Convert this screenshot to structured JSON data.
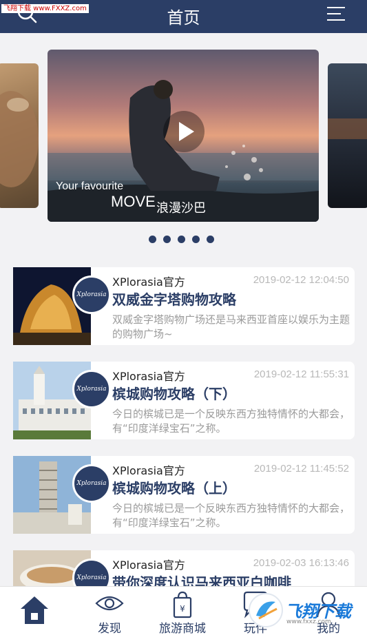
{
  "header": {
    "title": "首页",
    "watermark": "飞翔下载 www.FXXZ.com"
  },
  "carousel": {
    "caption_line1": "Your favourite",
    "caption_move": "MOVE",
    "caption_place": "浪漫沙巴",
    "slides_count": 5
  },
  "articles": [
    {
      "author": "XPlorasia官方",
      "date": "2019-02-12 12:04:50",
      "title": "双威金字塔购物攻略",
      "desc": "双威金字塔购物广场还是马来西亚首座以娱乐为主题的购物广场~",
      "avatar_text": "Xplorasia"
    },
    {
      "author": "XPlorasia官方",
      "date": "2019-02-12 11:55:31",
      "title": "槟城购物攻略（下）",
      "desc": "今日的槟城已是一个反映东西方独特情怀的大都会，有“印度洋绿宝石”之称。",
      "avatar_text": "Xplorasia"
    },
    {
      "author": "XPlorasia官方",
      "date": "2019-02-12 11:45:52",
      "title": "槟城购物攻略（上）",
      "desc": "今日的槟城已是一个反映东西方独特情怀的大都会，有“印度洋绿宝石”之称。",
      "avatar_text": "Xplorasia"
    },
    {
      "author": "XPlorasia官方",
      "date": "2019-02-03 16:13:46",
      "title": "带你深度认识马来西亚白咖啡",
      "desc": "",
      "avatar_text": "Xplorasia"
    }
  ],
  "tabs": [
    {
      "label": "",
      "icon": "home-icon"
    },
    {
      "label": "发现",
      "icon": "eye-icon"
    },
    {
      "label": "旅游商城",
      "icon": "shopping-bag-icon"
    },
    {
      "label": "玩伴",
      "icon": "chat-icon"
    },
    {
      "label": "我的",
      "icon": "user-icon"
    }
  ],
  "brand_watermark": {
    "text": "飞翔下载",
    "url": "www.fxxz.com"
  },
  "colors": {
    "primary": "#2b3e66",
    "background": "#f2f2f4",
    "muted_text": "#9a9a9a"
  }
}
